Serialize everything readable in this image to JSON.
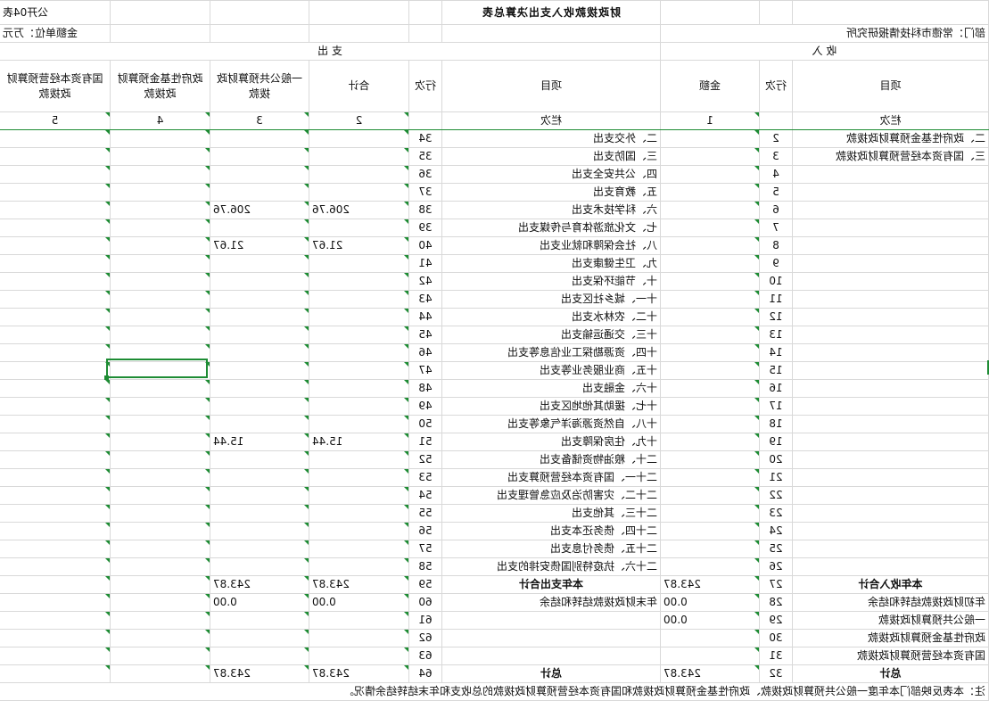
{
  "header": {
    "form_no": "公开04表",
    "title": "财政拨款收入支出决算总表",
    "department": "部门：常德市科技情报研究所",
    "unit": "金额单位：万元"
  },
  "sections": {
    "income": "收      入",
    "expense": "支      出"
  },
  "columns": {
    "income_item": "项目",
    "income_line": "行次",
    "income_amount": "金额",
    "expense_item": "项目",
    "expense_line": "行次",
    "total": "合计",
    "general_budget": "一般公共预算财政拨款",
    "gov_fund": "政府性基金预算财政拨款",
    "state_capital": "国有资本经营预算财政拨款"
  },
  "index_row": {
    "label_income": "栏次",
    "c1": "1",
    "label_expense": "栏次",
    "c2": "2",
    "c3": "3",
    "c4": "4",
    "c5": "5"
  },
  "rows": [
    {
      "ii": "二、政府性基金预算财政拨款",
      "il": "2",
      "ia": "",
      "ei": "二、外交支出",
      "el": "34",
      "et": "",
      "eg": "",
      "ef": "",
      "es": ""
    },
    {
      "ii": "三、国有资本经营预算财政拨款",
      "il": "3",
      "ia": "",
      "ei": "三、国防支出",
      "el": "35",
      "et": "",
      "eg": "",
      "ef": "",
      "es": ""
    },
    {
      "ii": "",
      "il": "4",
      "ia": "",
      "ei": "四、公共安全支出",
      "el": "36",
      "et": "",
      "eg": "",
      "ef": "",
      "es": ""
    },
    {
      "ii": "",
      "il": "5",
      "ia": "",
      "ei": "五、教育支出",
      "el": "37",
      "et": "",
      "eg": "",
      "ef": "",
      "es": ""
    },
    {
      "ii": "",
      "il": "6",
      "ia": "",
      "ei": "六、科学技术支出",
      "el": "38",
      "et": "206.76",
      "eg": "206.76",
      "ef": "",
      "es": ""
    },
    {
      "ii": "",
      "il": "7",
      "ia": "",
      "ei": "七、文化旅游体育与传媒支出",
      "el": "39",
      "et": "",
      "eg": "",
      "ef": "",
      "es": ""
    },
    {
      "ii": "",
      "il": "8",
      "ia": "",
      "ei": "八、社会保障和就业支出",
      "el": "40",
      "et": "21.67",
      "eg": "21.67",
      "ef": "",
      "es": ""
    },
    {
      "ii": "",
      "il": "9",
      "ia": "",
      "ei": "九、卫生健康支出",
      "el": "41",
      "et": "",
      "eg": "",
      "ef": "",
      "es": ""
    },
    {
      "ii": "",
      "il": "10",
      "ia": "",
      "ei": "十、节能环保支出",
      "el": "42",
      "et": "",
      "eg": "",
      "ef": "",
      "es": ""
    },
    {
      "ii": "",
      "il": "11",
      "ia": "",
      "ei": "十一、城乡社区支出",
      "el": "43",
      "et": "",
      "eg": "",
      "ef": "",
      "es": ""
    },
    {
      "ii": "",
      "il": "12",
      "ia": "",
      "ei": "十二、农林水支出",
      "el": "44",
      "et": "",
      "eg": "",
      "ef": "",
      "es": ""
    },
    {
      "ii": "",
      "il": "13",
      "ia": "",
      "ei": "十三、交通运输支出",
      "el": "45",
      "et": "",
      "eg": "",
      "ef": "",
      "es": ""
    },
    {
      "ii": "",
      "il": "14",
      "ia": "",
      "ei": "十四、资源勘探工业信息等支出",
      "el": "46",
      "et": "",
      "eg": "",
      "ef": "",
      "es": ""
    },
    {
      "ii": "",
      "il": "15",
      "ia": "",
      "ei": "十五、商业服务业等支出",
      "el": "47",
      "et": "",
      "eg": "",
      "ef": "",
      "es": ""
    },
    {
      "ii": "",
      "il": "16",
      "ia": "",
      "ei": "十六、金融支出",
      "el": "48",
      "et": "",
      "eg": "",
      "ef": "",
      "es": ""
    },
    {
      "ii": "",
      "il": "17",
      "ia": "",
      "ei": "十七、援助其他地区支出",
      "el": "49",
      "et": "",
      "eg": "",
      "ef": "",
      "es": ""
    },
    {
      "ii": "",
      "il": "18",
      "ia": "",
      "ei": "十八、自然资源海洋气象等支出",
      "el": "50",
      "et": "",
      "eg": "",
      "ef": "",
      "es": ""
    },
    {
      "ii": "",
      "il": "19",
      "ia": "",
      "ei": "十九、住房保障支出",
      "el": "51",
      "et": "15.44",
      "eg": "15.44",
      "ef": "",
      "es": ""
    },
    {
      "ii": "",
      "il": "20",
      "ia": "",
      "ei": "二十、粮油物资储备支出",
      "el": "52",
      "et": "",
      "eg": "",
      "ef": "",
      "es": ""
    },
    {
      "ii": "",
      "il": "21",
      "ia": "",
      "ei": "二十一、国有资本经营预算支出",
      "el": "53",
      "et": "",
      "eg": "",
      "ef": "",
      "es": ""
    },
    {
      "ii": "",
      "il": "22",
      "ia": "",
      "ei": "二十二、灾害防治及应急管理支出",
      "el": "54",
      "et": "",
      "eg": "",
      "ef": "",
      "es": ""
    },
    {
      "ii": "",
      "il": "23",
      "ia": "",
      "ei": "二十三、其他支出",
      "el": "55",
      "et": "",
      "eg": "",
      "ef": "",
      "es": ""
    },
    {
      "ii": "",
      "il": "24",
      "ia": "",
      "ei": "二十四、债务还本支出",
      "el": "56",
      "et": "",
      "eg": "",
      "ef": "",
      "es": ""
    },
    {
      "ii": "",
      "il": "25",
      "ia": "",
      "ei": "二十五、债务付息支出",
      "el": "57",
      "et": "",
      "eg": "",
      "ef": "",
      "es": ""
    },
    {
      "ii": "",
      "il": "26",
      "ia": "",
      "ei": "二十六、抗疫特别国债安排的支出",
      "el": "58",
      "et": "",
      "eg": "",
      "ef": "",
      "es": ""
    },
    {
      "ii": "本年收入合计",
      "il": "27",
      "ia": "243.87",
      "ei": "本年支出合计",
      "el": "59",
      "et": "243.87",
      "eg": "243.87",
      "ef": "",
      "es": "",
      "bold": true
    },
    {
      "ii": "年初财政拨款结转和结余",
      "il": "28",
      "ia": "0.00",
      "ei": "年末财政拨款结转和结余",
      "el": "60",
      "et": "0.00",
      "eg": "0.00",
      "ef": "",
      "es": ""
    },
    {
      "ii": "一般公共预算财政拨款",
      "il": "29",
      "ia": "0.00",
      "ei": "",
      "el": "61",
      "et": "",
      "eg": "",
      "ef": "",
      "es": ""
    },
    {
      "ii": "政府性基金预算财政拨款",
      "il": "30",
      "ia": "",
      "ei": "",
      "el": "62",
      "et": "",
      "eg": "",
      "ef": "",
      "es": ""
    },
    {
      "ii": "国有资本经营预算财政拨款",
      "il": "31",
      "ia": "",
      "ei": "",
      "el": "63",
      "et": "",
      "eg": "",
      "ef": "",
      "es": ""
    },
    {
      "ii": "总计",
      "il": "32",
      "ia": "243.87",
      "ei": "总计",
      "el": "64",
      "et": "243.87",
      "eg": "243.87",
      "ef": "",
      "es": "",
      "bold": true
    }
  ],
  "note": "注：本表反映部门本年度一般公共预算财政拨款、政府性基金预算财政拨款和国有资本经营预算财政拨款的总收支和年末结转结余情况。"
}
